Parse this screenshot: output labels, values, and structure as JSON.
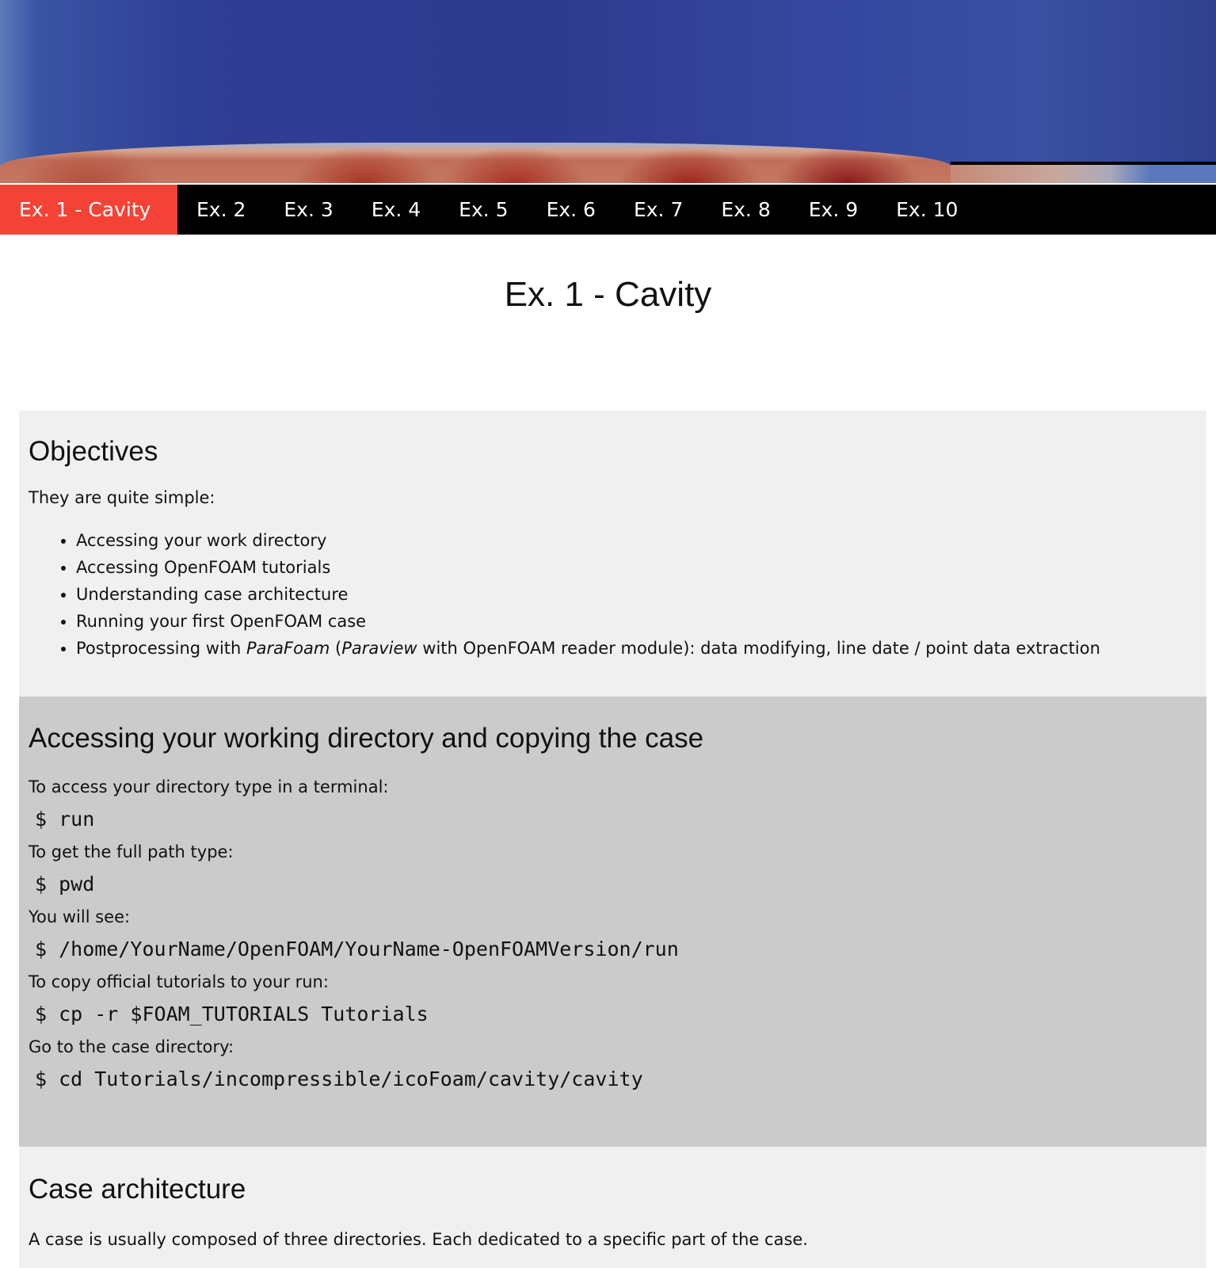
{
  "nav": {
    "tabs": [
      "Ex. 1 - Cavity",
      "Ex. 2",
      "Ex. 3",
      "Ex. 4",
      "Ex. 5",
      "Ex. 6",
      "Ex. 7",
      "Ex. 8",
      "Ex. 9",
      "Ex. 10"
    ],
    "active": 0,
    "active_color": "#f44336"
  },
  "page_title": "Ex. 1 - Cavity",
  "objectives": {
    "heading": "Objectives",
    "intro": "They are quite simple:",
    "items": [
      "Accessing your work directory",
      "Accessing OpenFOAM tutorials",
      "Understanding case architecture",
      "Running your first OpenFOAM case"
    ],
    "last_item": {
      "a": "Postprocessing with ",
      "b": "ParaFoam",
      "c": " (",
      "d": "Paraview",
      "e": " with OpenFOAM reader module): data modifying, line date / point data extraction"
    }
  },
  "access": {
    "heading": "Accessing your working directory and copying the case",
    "steps": [
      {
        "text": "To access your directory type in a terminal:",
        "code": "$ run"
      },
      {
        "text": "To get the full path type:",
        "code": "$ pwd"
      },
      {
        "text": "You will see:",
        "code": "$ /home/YourName/OpenFOAM/YourName-OpenFOAMVersion/run"
      },
      {
        "text": "To copy official tutorials to your run:",
        "code": "$ cp -r $FOAM_TUTORIALS Tutorials"
      },
      {
        "text": "Go to the case directory:",
        "code": "$ cd Tutorials/incompressible/icoFoam/cavity/cavity"
      }
    ]
  },
  "architecture": {
    "heading": "Case architecture",
    "text": "A case is usually composed of three directories. Each dedicated to a specific part of the case."
  }
}
